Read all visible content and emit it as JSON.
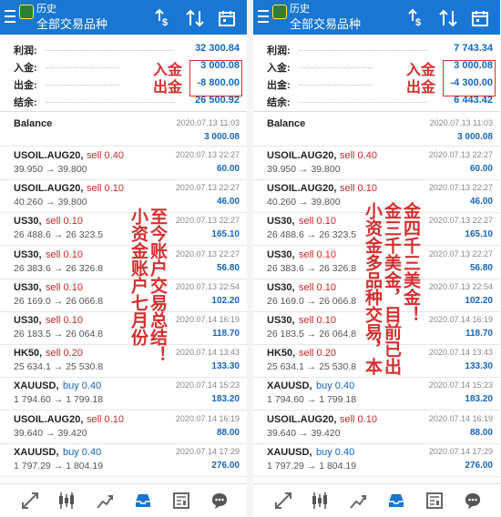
{
  "header": {
    "title": "历史",
    "subtitle": "全部交易品种"
  },
  "left": {
    "summary": [
      {
        "label": "利润:",
        "value": "32 300.84"
      },
      {
        "label": "入金:",
        "value": "3 000.08"
      },
      {
        "label": "出金:",
        "value": "-8 800.00"
      },
      {
        "label": "结余:",
        "value": "26 500.92"
      }
    ],
    "annotation_in": "入金",
    "annotation_out": "出金",
    "annotation_text_a": "小资金账户七月份",
    "annotation_text_b": "至今账户交易总结！"
  },
  "right": {
    "summary": [
      {
        "label": "利润:",
        "value": "7 743.34"
      },
      {
        "label": "入金:",
        "value": "3 000.08"
      },
      {
        "label": "出金:",
        "value": "-4 300.00"
      },
      {
        "label": "结余:",
        "value": "6 443.42"
      }
    ],
    "annotation_in": "入金",
    "annotation_out": "出金",
    "annotation_text_a": "小资金多品种交易，本",
    "annotation_text_b": "金三千美金，目前已出",
    "annotation_text_c": "金四千三美金！"
  },
  "balance": {
    "label": "Balance",
    "time": "2020.07.13 11:03",
    "value": "3 000.08"
  },
  "deals": [
    {
      "symbol": "USOIL.AUG20,",
      "side": "sell 0.40",
      "type": "sell",
      "prices": "39.950 → 39.800",
      "time": "2020.07.13 22:27",
      "profit": "60.00"
    },
    {
      "symbol": "USOIL.AUG20,",
      "side": "sell 0.10",
      "type": "sell",
      "prices": "40.260 → 39.800",
      "time": "2020.07.13 22:27",
      "profit": "46.00"
    },
    {
      "symbol": "US30,",
      "side": "sell 0.10",
      "type": "sell",
      "prices": "26 488.6 → 26 323.5",
      "time": "2020.07.13 22:27",
      "profit": "165.10"
    },
    {
      "symbol": "US30,",
      "side": "sell 0.10",
      "type": "sell",
      "prices": "26 383.6 → 26 326.8",
      "time": "2020.07.13 22:27",
      "profit": "56.80"
    },
    {
      "symbol": "US30,",
      "side": "sell 0.10",
      "type": "sell",
      "prices": "26 169.0 → 26 066.8",
      "time": "2020.07.13 22:54",
      "profit": "102.20"
    },
    {
      "symbol": "US30,",
      "side": "sell 0.10",
      "type": "sell",
      "prices": "26 183.5 → 26 064.8",
      "time": "2020.07.14 16:19",
      "profit": "118.70"
    },
    {
      "symbol": "HK50,",
      "side": "sell 0.20",
      "type": "sell",
      "prices": "25 634.1 → 25 530.8",
      "time": "2020.07.14 13:43",
      "profit": "133.30"
    },
    {
      "symbol": "XAUUSD,",
      "side": "buy 0.40",
      "type": "buy",
      "prices": "1 794.60 → 1 799.18",
      "time": "2020.07.14 15:23",
      "profit": "183.20"
    },
    {
      "symbol": "USOIL.AUG20,",
      "side": "sell 0.10",
      "type": "sell",
      "prices": "39.640 → 39.420",
      "time": "2020.07.14 16:19",
      "profit": "88.00"
    },
    {
      "symbol": "XAUUSD,",
      "side": "buy 0.40",
      "type": "buy",
      "prices": "1 797.29 → 1 804.19",
      "time": "2020.07.14 17:29",
      "profit": "276.00"
    }
  ],
  "icons": [
    "menu-icon",
    "sort-dollar-icon",
    "sort-arrows-icon",
    "calendar-icon",
    "trade-icon",
    "candles-icon",
    "chart-icon",
    "inbox-icon",
    "news-icon",
    "chat-icon"
  ],
  "colors": {
    "header": "#1976d2",
    "sell": "#c62828",
    "buy": "#1565c0",
    "annotation": "#d32f2f"
  }
}
